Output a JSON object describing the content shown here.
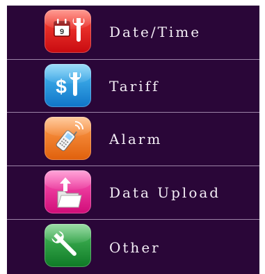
{
  "menu": {
    "items": [
      {
        "label": "Date/Time",
        "icon": "calendar-wrench-icon",
        "calendar_day": "9",
        "color": "#e8141e"
      },
      {
        "label": "Tariff",
        "icon": "dollar-wrench-icon",
        "currency_symbol": "$",
        "color": "#1e9be0"
      },
      {
        "label": "Alarm",
        "icon": "phone-signal-icon",
        "color": "#f07a20"
      },
      {
        "label": "Data Upload",
        "icon": "folder-upload-icon",
        "color": "#e8168a"
      },
      {
        "label": "Other",
        "icon": "wrench-icon",
        "color": "#1f9a3a"
      }
    ]
  }
}
